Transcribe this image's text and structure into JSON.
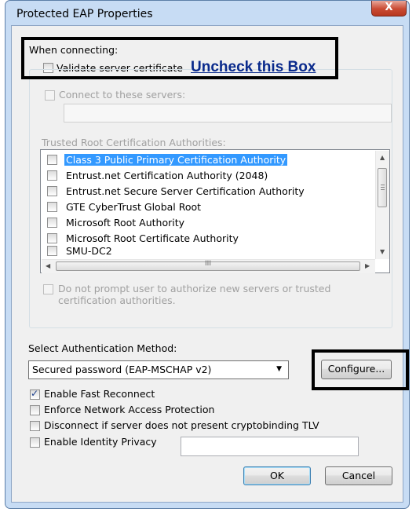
{
  "window": {
    "title": "Protected EAP Properties",
    "close_glyph": "X"
  },
  "connection": {
    "heading": "When connecting:",
    "validate_label": "Validate server certificate",
    "validate_checked": false,
    "connect_servers_label": "Connect to these servers:",
    "servers_value": "",
    "trusted_heading": "Trusted Root Certification Authorities:",
    "ca_items": [
      {
        "label": "Class 3 Public Primary Certification Authority",
        "selected": true,
        "checked": false
      },
      {
        "label": "Entrust.net Certification Authority (2048)",
        "selected": false,
        "checked": false
      },
      {
        "label": "Entrust.net Secure Server Certification Authority",
        "selected": false,
        "checked": false
      },
      {
        "label": "GTE CyberTrust Global Root",
        "selected": false,
        "checked": false
      },
      {
        "label": "Microsoft Root Authority",
        "selected": false,
        "checked": false
      },
      {
        "label": "Microsoft Root Certificate Authority",
        "selected": false,
        "checked": false
      },
      {
        "label": "SMU-DC2",
        "selected": false,
        "checked": false
      }
    ],
    "hscroll_grip": "III",
    "no_prompt_line1": "Do not prompt user to authorize new servers or trusted",
    "no_prompt_line2": "certification authorities."
  },
  "annotation": {
    "uncheck_text": "Uncheck this Box"
  },
  "auth": {
    "heading": "Select Authentication Method:",
    "method": "Secured password (EAP-MSCHAP v2)",
    "configure_label": "Configure..."
  },
  "options": {
    "fast_reconnect": "Enable Fast Reconnect",
    "fast_reconnect_checked": true,
    "nap": "Enforce Network Access Protection",
    "disconnect_tlv": "Disconnect if server does not present cryptobinding TLV",
    "identity_privacy": "Enable Identity Privacy",
    "identity_value": ""
  },
  "buttons": {
    "ok": "OK",
    "cancel": "Cancel"
  },
  "colors": {
    "selection": "#3399ff",
    "annotation_text": "#0a2a8c",
    "frame": "#c7dcf4"
  }
}
